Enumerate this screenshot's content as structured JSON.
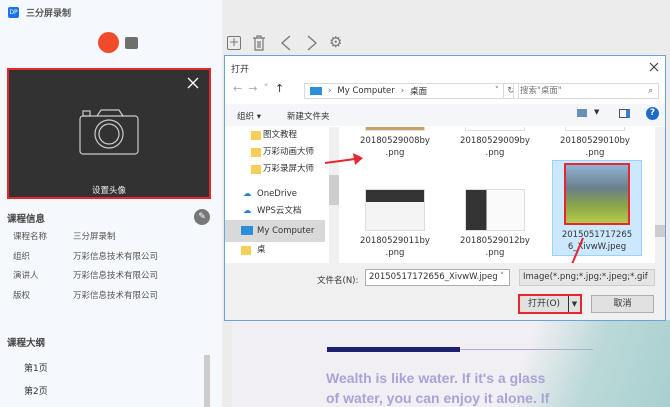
{
  "app": {
    "title": "三分屏录制",
    "logo": "DP"
  },
  "avatar": {
    "label": "设置头像"
  },
  "course_info": {
    "heading": "课程信息",
    "rows": [
      {
        "label": "课程名称",
        "value": "三分屏录制"
      },
      {
        "label": "组织",
        "value": "万彩信息技术有限公司"
      },
      {
        "label": "演讲人",
        "value": "万彩信息技术有限公司"
      },
      {
        "label": "版权",
        "value": "万彩信息技术有限公司"
      }
    ]
  },
  "outline": {
    "heading": "课程大纲",
    "pages": [
      "第1页",
      "第2页"
    ]
  },
  "slide": {
    "lines": [
      "Wealth is like water. If it's a glass",
      "of water, you can enjoy it alone. If"
    ]
  },
  "dialog": {
    "title": "打开",
    "path": [
      "My Computer",
      "桌面"
    ],
    "search_placeholder": "搜索\"桌面\"",
    "organize": "组织 ▾",
    "new_folder": "新建文件夹",
    "nav": [
      "图文教程",
      "万彩动画大师",
      "万彩录屏大师",
      "OneDrive",
      "WPS云文档",
      "My Computer",
      "桌"
    ],
    "files": [
      {
        "name1": "20180529008by",
        "name2": ".png"
      },
      {
        "name1": "20180529009by",
        "name2": ".png"
      },
      {
        "name1": "20180529010by",
        "name2": ".png"
      },
      {
        "name1": "20180529011by",
        "name2": ".png"
      },
      {
        "name1": "20180529012by",
        "name2": ".png"
      },
      {
        "name1": "2015051717265",
        "name2": "6_XivwW.jpeg"
      }
    ],
    "filename_label": "文件名(N):",
    "filename_value": "20150517172656_XivwW.jpeg",
    "filetype": "Image(*.png;*.jpg;*.jpeg;*.gif",
    "open": "打开(O)",
    "cancel": "取消"
  },
  "colors": {
    "record": "#f24a2d",
    "highlight": "#e8262d",
    "accent": "#1a73e8"
  }
}
